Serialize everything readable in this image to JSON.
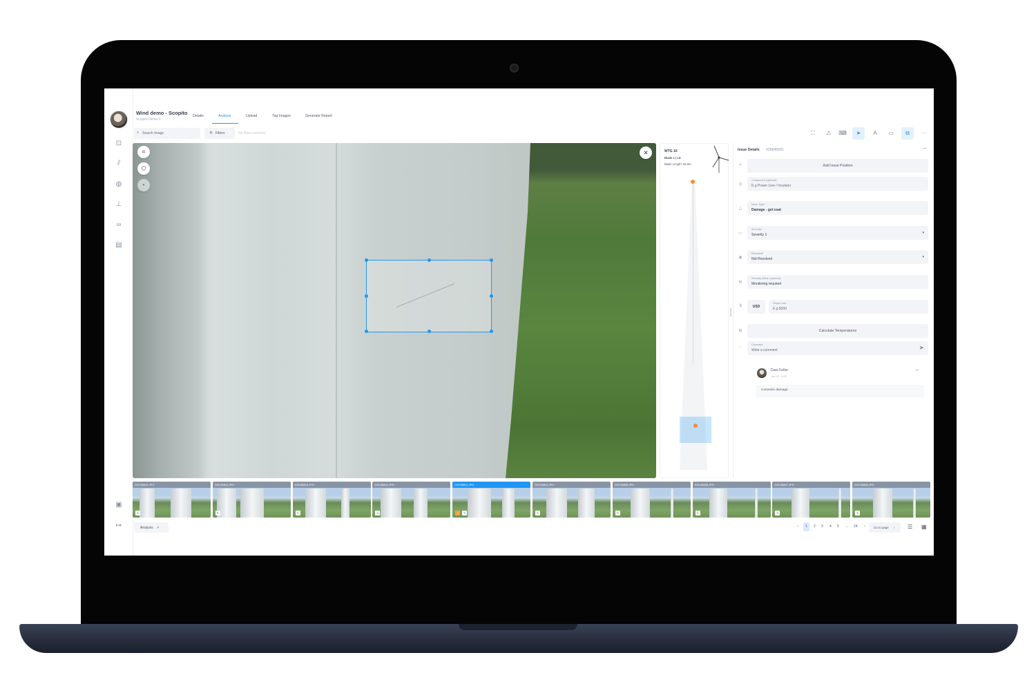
{
  "project": {
    "title": "Wind demo - Scopito",
    "subtitle": "Scopito Demo 1"
  },
  "tabs": [
    {
      "label": "Details"
    },
    {
      "label": "Analyze"
    },
    {
      "label": "Upload"
    },
    {
      "label": "Tag Images"
    },
    {
      "label": "Generate Report"
    }
  ],
  "active_tab": "Analyze",
  "toolbar": {
    "search_placeholder": "Search Image",
    "filters_label": "Filters",
    "no_filters_text": "No filters selected",
    "tools": [
      "fullscreen-icon",
      "warning-icon",
      "keyboard-icon",
      "send-location-icon",
      "text-icon",
      "image-icon",
      "image-edit-icon",
      "more-icon"
    ]
  },
  "blade": {
    "wtg": "WTG 16",
    "name": "Blade 1 | LE",
    "length": "Blade Length: 55.0m"
  },
  "issue": {
    "title": "Issue Details",
    "id": "#26845561",
    "add_position_label": "Add Issue Position",
    "component_label": "Component (optional)",
    "component_placeholder": "E.g Power Line / Insulator",
    "issue_type_label": "Issue Type*",
    "issue_type_value": "Damage - gel coat",
    "severity_label": "Severity*",
    "severity_value": "Severity 1",
    "resolved_label": "Resolved*",
    "resolved_value": "Not Resolved",
    "remedy_label": "Remedy Action (optional)",
    "remedy_value": "Monitoring required",
    "currency": "USD",
    "repair_cost_label": "Repair cost",
    "repair_cost_placeholder": "E.g $300",
    "calculate_label": "Calculate Temperatures",
    "comment_label": "Comment",
    "comment_placeholder": "Write a comment"
  },
  "comment": {
    "author": "Dani Feller",
    "date": "Jan 23, 2020",
    "text": "Cosmetic damage."
  },
  "thumbnails": [
    {
      "name": "DSC06815.JPG",
      "selected": false,
      "flagged": false
    },
    {
      "name": "DSC06814.JPG",
      "selected": false,
      "flagged": false
    },
    {
      "name": "DSC06813.JPG",
      "selected": false,
      "flagged": false
    },
    {
      "name": "DSC06812.JPG",
      "selected": false,
      "flagged": false
    },
    {
      "name": "DSC06811.JPG",
      "selected": true,
      "flagged": true
    },
    {
      "name": "DSC06810.JPG",
      "selected": false,
      "flagged": false
    },
    {
      "name": "DSC06809.JPG",
      "selected": false,
      "flagged": false
    },
    {
      "name": "DSC06808.JPG",
      "selected": false,
      "flagged": false
    },
    {
      "name": "DSC06807.JPG",
      "selected": false,
      "flagged": false
    },
    {
      "name": "DSC06806.JPG",
      "selected": false,
      "flagged": false
    }
  ],
  "footer": {
    "analysis_label": "Analysis",
    "pages": [
      "1",
      "2",
      "3",
      "4",
      "5",
      "...",
      "24"
    ],
    "current_page": "1",
    "goto_label": "Go to page"
  },
  "colors": {
    "accent": "#2196f3",
    "marker": "#ff8a34",
    "field_bg": "#f2f4f7"
  }
}
